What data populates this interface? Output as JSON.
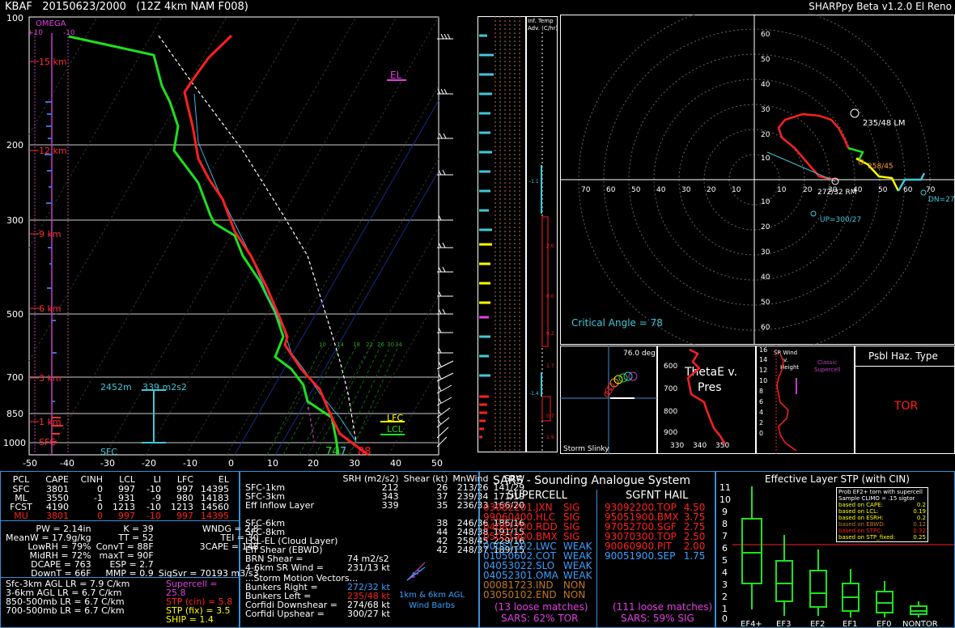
{
  "header": {
    "station": "KBAF",
    "run": "20150623/2000",
    "model": "(12Z  4km NAM  F008)",
    "app": "SHARPpy Beta v1.2.0 El Reno"
  },
  "skewt": {
    "pressure_labels": [
      "100",
      "200",
      "300",
      "500",
      "700",
      "850",
      "1000"
    ],
    "temp_labels": [
      "-50",
      "-40",
      "-30",
      "-20",
      "-10",
      "0",
      "10",
      "20",
      "30",
      "40",
      "50"
    ],
    "height_labels": [
      "15 km",
      "12 km",
      "9 km",
      "6 km",
      "3 km",
      "1 km",
      "SFC"
    ],
    "omega_label": "OMEGA",
    "omega_scale": [
      "+10",
      "-10"
    ],
    "el_label": "EL",
    "lfc_label": "LFC",
    "lcl_label": "LCL",
    "sfc_label": "SFC",
    "sfc_td": "74",
    "sfc_wb": "7",
    "sfc_t": "88",
    "eff_layer_left": "2452m",
    "eff_layer_right": "339 m2s2",
    "mix_ratios": [
      "10",
      "14",
      "18",
      "22",
      "26",
      "30",
      "34"
    ]
  },
  "inferred_temp": {
    "title": "Inf. Temp\nAdv. (C/hr)",
    "values": [
      "-1.1",
      "2.0",
      "0.0",
      "0.2",
      "1.7",
      "-1.4",
      "0.7",
      "1.9"
    ]
  },
  "hodograph": {
    "rings": [
      "10",
      "20",
      "30",
      "40",
      "50",
      "60"
    ],
    "x_labels": [
      "70",
      "60",
      "50",
      "40",
      "30",
      "20",
      "10",
      "10",
      "20",
      "30",
      "40",
      "50",
      "60",
      "70"
    ],
    "lm_label": "235/48 LM",
    "rm_label": "272/32 RM",
    "mean_label": "258/45",
    "up_label": "UP=300/27",
    "dn_label": "DN=274/68",
    "critical_angle": "Critical Angle = 78"
  },
  "storm_slinky": {
    "angle": "76.0 deg",
    "title": "Storm Slinky"
  },
  "thetae": {
    "title": "ThetaE v.\nPres",
    "y_labels": [
      "600",
      "700",
      "800",
      "900"
    ],
    "x_labels": [
      "330",
      "340",
      "350"
    ]
  },
  "srwind": {
    "title": "SR Wind\nv.\nHeight",
    "note": "Classic\nSupercell",
    "y_labels": [
      "16",
      "14",
      "12",
      "10",
      "8",
      "6",
      "4",
      "2",
      "0"
    ]
  },
  "hazard": {
    "title": "Psbl Haz. Type",
    "value": "TOR"
  },
  "parcels": {
    "headers": [
      "PCL",
      "CAPE",
      "CINH",
      "LCL",
      "LI",
      "LFC",
      "EL"
    ],
    "rows": [
      [
        "SFC",
        "3801",
        "0",
        "997",
        "-10",
        "997",
        "14395"
      ],
      [
        "ML",
        "3550",
        "-1",
        "931",
        "-9",
        "980",
        "14183"
      ],
      [
        "FCST",
        "4190",
        "0",
        "1213",
        "-10",
        "1213",
        "14560"
      ],
      [
        "MU",
        "3801",
        "0",
        "997",
        "-10",
        "997",
        "14395"
      ]
    ]
  },
  "indices": [
    [
      "PW = 2.14in",
      "K = 39",
      "WNDG = 2.8"
    ],
    [
      "MeanW = 17.9g/kg",
      "TT = 52",
      "TEI = 30"
    ],
    [
      "LowRH = 79%",
      "ConvT = 88F",
      "3CAPE = 148"
    ],
    [
      "MidRH = 72%",
      "maxT = 90F",
      ""
    ],
    [
      "DCAPE = 763",
      "ESP = 2.7",
      ""
    ],
    [
      "DownT = 66F",
      "MMP = 0.9",
      "SigSvr = 70193 m3/s3"
    ]
  ],
  "lapse": [
    "Sfc-3km AGL LR = 7.9 C/km",
    "3-6km AGL LR = 6.7 C/km",
    "850-500mb LR = 6.7 C/km",
    "700-500mb LR = 6.7 C/km"
  ],
  "composites": [
    {
      "label": "Supercell = 25.8",
      "color": "#e040e0"
    },
    {
      "label": "STP (cin) = 5.8",
      "color": "#ff2020"
    },
    {
      "label": "STP (fix) = 3.5",
      "color": "#ffff00"
    },
    {
      "label": "SHIP = 1.4",
      "color": "#ffff00"
    }
  ],
  "kinematics": {
    "headers": [
      "",
      "SRH (m2/s2)",
      "Shear (kt)",
      "MnWind",
      "SRW"
    ],
    "rows": [
      [
        "SFC-1km",
        "212",
        "26",
        "213/26",
        "141/29"
      ],
      [
        "SFC-3km",
        "343",
        "37",
        "239/34",
        "171/19"
      ],
      [
        "Eff Inflow Layer",
        "339",
        "35",
        "236/33",
        "166/20"
      ],
      [
        "",
        "",
        "",
        "",
        ""
      ],
      [
        "SFC-6km",
        "",
        "38",
        "246/36",
        "186/16"
      ],
      [
        "SFC-8km",
        "",
        "44",
        "248/38",
        "191/15"
      ],
      [
        "LCL-EL (Cloud Layer)",
        "",
        "42",
        "258/45",
        "229/16"
      ],
      [
        "Eff Shear (EBWD)",
        "",
        "42",
        "248/37",
        "189/15"
      ]
    ],
    "brn": "BRN Shear =",
    "brn_val": "74 m2/s2",
    "sr46": "4-6km SR Wind =",
    "sr46_val": "231/13 kt",
    "smv_title": "...Storm Motion Vectors...",
    "vectors": [
      {
        "label": "Bunkers Right =",
        "val": "272/32 kt",
        "color": "#3aa0ff"
      },
      {
        "label": "Bunkers Left =",
        "val": "235/48 kt",
        "color": "#ff2020"
      },
      {
        "label": "Corfidi Downshear =",
        "val": "274/68 kt",
        "color": "#fff"
      },
      {
        "label": "Corfidi Upshear =",
        "val": "300/27 kt",
        "color": "#fff"
      }
    ],
    "barb_note": "1km & 6km AGL\nWind Barbs"
  },
  "sars": {
    "title": "SARS - Sounding Analogue System",
    "sup_title": "SUPERCELL",
    "hail_title": "SGFNT HAIL",
    "supercell": [
      [
        "03082201.JXN",
        "SIG",
        "#ff2020"
      ],
      [
        "99060400.HLC",
        "SIG",
        "#ff2020"
      ],
      [
        "04082700.RDD",
        "SIG",
        "#ff2020"
      ],
      [
        "05051900.BMX",
        "SIG",
        "#ff2020"
      ],
      [
        "00051202.LWC",
        "WEAK",
        "#3aa0ff"
      ],
      [
        "01050602.COT",
        "WEAK",
        "#3aa0ff"
      ],
      [
        "04053022.SLO",
        "WEAK",
        "#3aa0ff"
      ],
      [
        "04052301.OMA",
        "WEAK",
        "#3aa0ff"
      ],
      [
        "00081723.IND",
        "NON",
        "#c07820"
      ],
      [
        "03050102.END",
        "NON",
        "#c07820"
      ]
    ],
    "hail": [
      [
        "93092200.TOP",
        "4.50",
        "#ff2020"
      ],
      [
        "95051900.BMX",
        "3.75",
        "#ff2020"
      ],
      [
        "97052700.SGF",
        "2.75",
        "#ff2020"
      ],
      [
        "93070300.TOP",
        "2.50",
        "#ff2020"
      ],
      [
        "90060900.PIT",
        "2.00",
        "#ff2020"
      ],
      [
        "90051900.SEP",
        "1.75",
        "#3aa0ff"
      ]
    ],
    "sup_matches": "(13 loose matches)",
    "sup_prob": "SARS: 62% TOR",
    "hail_matches": "(111 loose matches)",
    "hail_prob": "SARS: 59% SIG"
  },
  "stp": {
    "title": "Effective Layer STP (with CIN)",
    "y_labels": [
      "11",
      "10",
      "9",
      "8",
      "7",
      "6",
      "5",
      "4",
      "3",
      "2",
      "1",
      "0"
    ],
    "categories": [
      "EF4+",
      "EF3",
      "EF2",
      "EF1",
      "EF0",
      "NONTOR"
    ],
    "legend_title": "Prob EF2+ torn with supercell",
    "legend_sub": "Sample CLIMO = .15 sigtor",
    "legend": [
      [
        "based on CAPE:",
        "0.2"
      ],
      [
        "based on LCL:",
        "0.19"
      ],
      [
        "based on ESRH:",
        "0.2"
      ],
      [
        "based on EBWD:",
        "0.12"
      ],
      [
        "based on STPC:",
        "0.32"
      ],
      [
        "based on STP_fixed:",
        "0.25"
      ]
    ]
  }
}
